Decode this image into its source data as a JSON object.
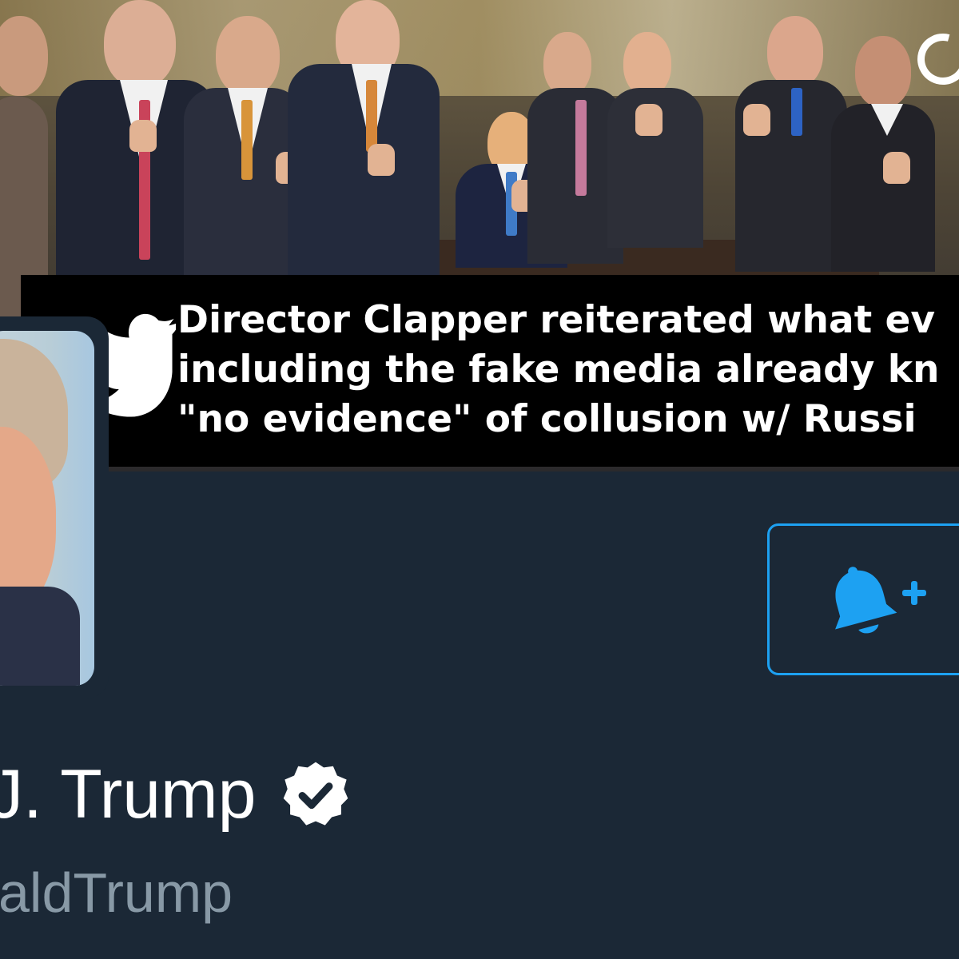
{
  "banner": {
    "caption_lines": [
      "Director Clapper reiterated what ev",
      "including the fake media already kn",
      "\"no evidence\" of collusion w/ Russi"
    ]
  },
  "icons": {
    "twitter_bird": "twitter-bird-icon",
    "notification": "bell-plus-icon",
    "verified": "verified-badge-icon",
    "top_right": "circle-icon"
  },
  "profile": {
    "display_name": "J. Trump",
    "handle": "aldTrump"
  },
  "colors": {
    "background": "#1b2836",
    "accent": "#1da1f2",
    "handle": "#8899a6"
  }
}
